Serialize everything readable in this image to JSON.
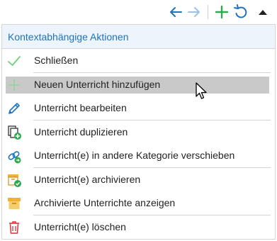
{
  "toolbar": {
    "back_icon": "arrow-left-icon",
    "forward_icon": "arrow-right-icon",
    "add_icon": "plus-icon",
    "refresh_icon": "refresh-icon",
    "collapse_icon": "triangle-up-icon",
    "accent": "#1e73be",
    "green": "#2fa84f"
  },
  "panel": {
    "title": "Kontextabhängige Aktionen",
    "items": [
      {
        "label": "Schließen",
        "icon": "check-icon"
      },
      {
        "label": "Neuen Unterricht hinzufügen",
        "icon": "plus-icon",
        "highlighted": true
      },
      {
        "label": "Unterricht bearbeiten",
        "icon": "pencil-icon"
      },
      {
        "label": "Unterricht duplizieren",
        "icon": "duplicate-icon"
      },
      {
        "label": "Unterricht(e) in andere Kategorie verschieben",
        "icon": "move-link-icon"
      },
      {
        "label": "Unterricht(e) archivieren",
        "icon": "archive-check-icon"
      },
      {
        "label": "Archivierte Unterrichte anzeigen",
        "icon": "archive-box-icon"
      },
      {
        "label": "Unterricht(e) löschen",
        "icon": "trash-icon"
      }
    ]
  }
}
